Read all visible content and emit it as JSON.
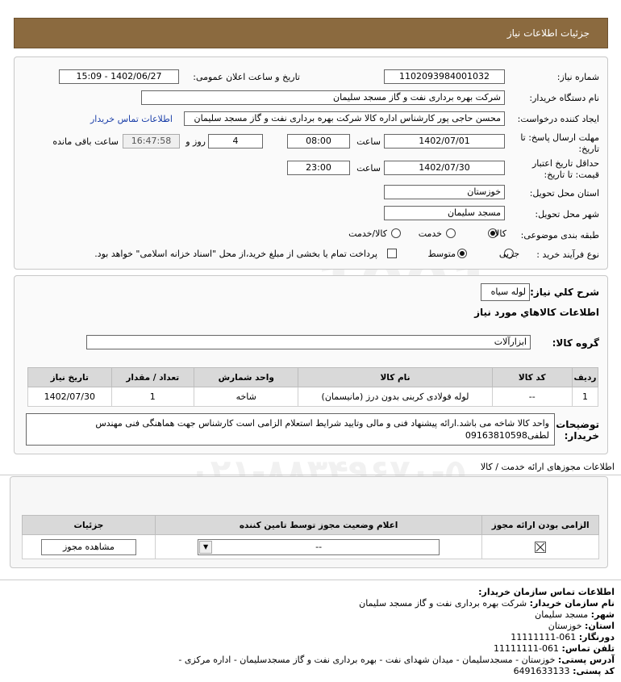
{
  "header": {
    "title": "جزئیات اطلاعات نیاز"
  },
  "form": {
    "need_number_label": "شماره نیاز:",
    "need_number": "1102093984001032",
    "announce_label": "تاریخ و ساعت اعلان عمومی:",
    "announce_value": "1402/06/27 - 15:09",
    "buyer_org_label": "نام دستگاه خریدار:",
    "buyer_org": "شرکت بهره برداری نفت و گاز مسجد سلیمان",
    "creator_label": "ایجاد کننده درخواست:",
    "creator": "محسن حاجی پور کارشناس اداره کالا  شرکت بهره برداری نفت و گاز مسجد سلیمان",
    "contact_link": "اطلاعات تماس خریدار",
    "deadline_label_1": "مهلت ارسال پاسخ: تا",
    "deadline_label_2": "تاریخ:",
    "deadline_date": "1402/07/01",
    "time_label": "ساعت",
    "deadline_time": "08:00",
    "days_value": "4",
    "days_label": "روز و",
    "remaining_time": "16:47:58",
    "remaining_label": "ساعت باقی مانده",
    "validity_label_1": "حداقل تاریخ اعتبار",
    "validity_label_2": "قیمت: تا تاریخ:",
    "validity_date": "1402/07/30",
    "validity_time": "23:00",
    "province_label": "استان محل تحویل:",
    "province": "خوزستان",
    "city_label": "شهر محل تحویل:",
    "city": "مسجد سلیمان",
    "category_label": "طبقه بندی موضوعی:",
    "category_options": [
      "کالا",
      "خدمت",
      "کالا/خدمت"
    ],
    "purchase_type_label": "نوع فرآیند خرید :",
    "purchase_options": [
      "جزیی",
      "متوسط"
    ],
    "payment_note": "پرداخت تمام یا بخشی از مبلغ خرید،از محل \"اسناد خزانه اسلامی\" خواهد بود."
  },
  "need": {
    "summary_label": "شرح کلي نياز:",
    "summary": "لوله سیاه",
    "goods_info_title": "اطلاعات کالاهاي مورد نياز",
    "group_label": "گروه کالا:",
    "group": "ابزارآلات",
    "table": {
      "headers": [
        "ردیف",
        "کد کالا",
        "نام کالا",
        "واحد شمارش",
        "تعداد / مقدار",
        "تاریخ نیاز"
      ],
      "rows": [
        {
          "row": "1",
          "code": "--",
          "name": "لوله فولادی کربنی بدون درز (مانیسمان)",
          "unit": "شاخه",
          "qty": "1",
          "date": "1402/07/30"
        }
      ]
    },
    "buyer_notes_label_1": "توضیحات",
    "buyer_notes_label_2": "خریدار:",
    "buyer_notes": "واحد کالا شاخه می باشد.ارائه پیشنهاد فنی و مالی وتایید شرایط استعلام الزامی است کارشناس جهت هماهنگی فنی مهندس لطفی09163810598"
  },
  "permits": {
    "title": "اطلاعات مجوزهای ارائه خدمت / کالا",
    "headers": [
      "الزامی بودن ارائه مجوز",
      "اعلام وضعیت مجوز توسط تامین کننده",
      "جزئیات"
    ],
    "row": {
      "status_value": "--",
      "view_button": "مشاهده مجوز"
    }
  },
  "contact": {
    "title": "اطلاعات تماس سازمان خریدار:",
    "org_label": "نام سازمان خریدار:",
    "org": "شرکت بهره برداری نفت و گاز مسجد سلیمان",
    "city_label": "شهر:",
    "city": "مسجد سلیمان",
    "province_label": "استان:",
    "province": "خوزستان",
    "fax_label": "دورنگار:",
    "fax": "061-11111111",
    "phone_label": "تلفن تماس:",
    "phone": "061-11111111",
    "address_label": "آدرس پستی:",
    "address": "خوزستان - مسجدسلیمان - میدان شهدای نفت - بهره برداری نفت و گاز مسجدسلیمان - اداره مرکزی -",
    "postal_label": "کد پستی:",
    "postal": "6491633133"
  },
  "watermark": {
    "brand": "ParsNamadData",
    "phone": "۰۲۱-۸۸۳۴۹۶۷۰-۵"
  }
}
